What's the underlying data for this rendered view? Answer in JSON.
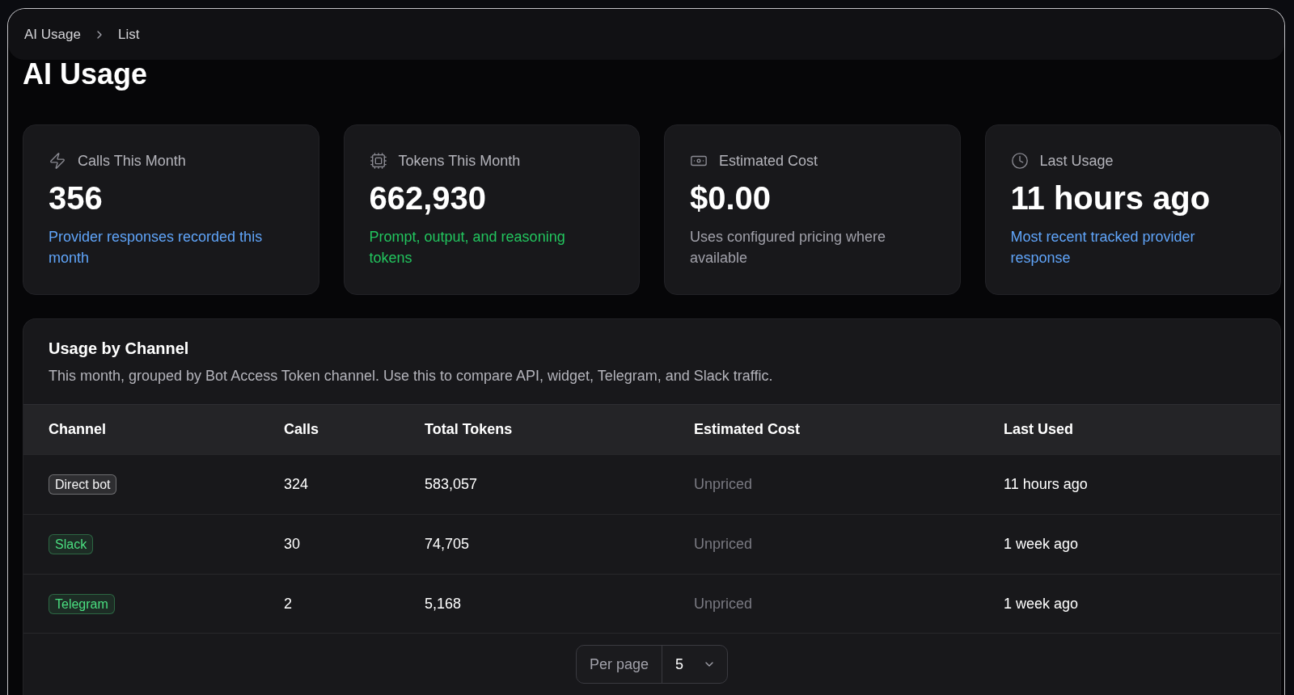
{
  "breadcrumbs": [
    {
      "label": "AI Usage"
    },
    {
      "label": "List"
    }
  ],
  "page": {
    "title": "AI Usage"
  },
  "stats": [
    {
      "label": "Calls This Month",
      "value": "356",
      "description": "Provider responses recorded this month",
      "color": "#60a5fa"
    },
    {
      "label": "Tokens This Month",
      "value": "662,930",
      "description": "Prompt, output, and reasoning tokens",
      "color": "#22c55e"
    },
    {
      "label": "Estimated Cost",
      "value": "$0.00",
      "description": "Uses configured pricing where available",
      "color": "#a1a1aa"
    },
    {
      "label": "Last Usage",
      "value": "11 hours ago",
      "description": "Most recent tracked provider response",
      "color": "#60a5fa"
    }
  ],
  "usage_by_channel": {
    "title": "Usage by Channel",
    "description": "This month, grouped by Bot Access Token channel. Use this to compare API, widget, Telegram, and Slack traffic.",
    "columns": [
      "Channel",
      "Calls",
      "Total Tokens",
      "Estimated Cost",
      "Last Used"
    ],
    "rows": [
      {
        "channel": {
          "label": "Direct bot",
          "color": "#f4f4f5"
        },
        "calls": "324",
        "total_tokens": "583,057",
        "estimated_cost": "Unpriced",
        "last_used": "11 hours ago"
      },
      {
        "channel": {
          "label": "Slack",
          "color": "#4ade80"
        },
        "calls": "30",
        "total_tokens": "74,705",
        "estimated_cost": "Unpriced",
        "last_used": "1 week ago"
      },
      {
        "channel": {
          "label": "Telegram",
          "color": "#4ade80"
        },
        "calls": "2",
        "total_tokens": "5,168",
        "estimated_cost": "Unpriced",
        "last_used": "1 week ago"
      }
    ]
  },
  "pagination": {
    "label": "Per page",
    "value": "5"
  }
}
